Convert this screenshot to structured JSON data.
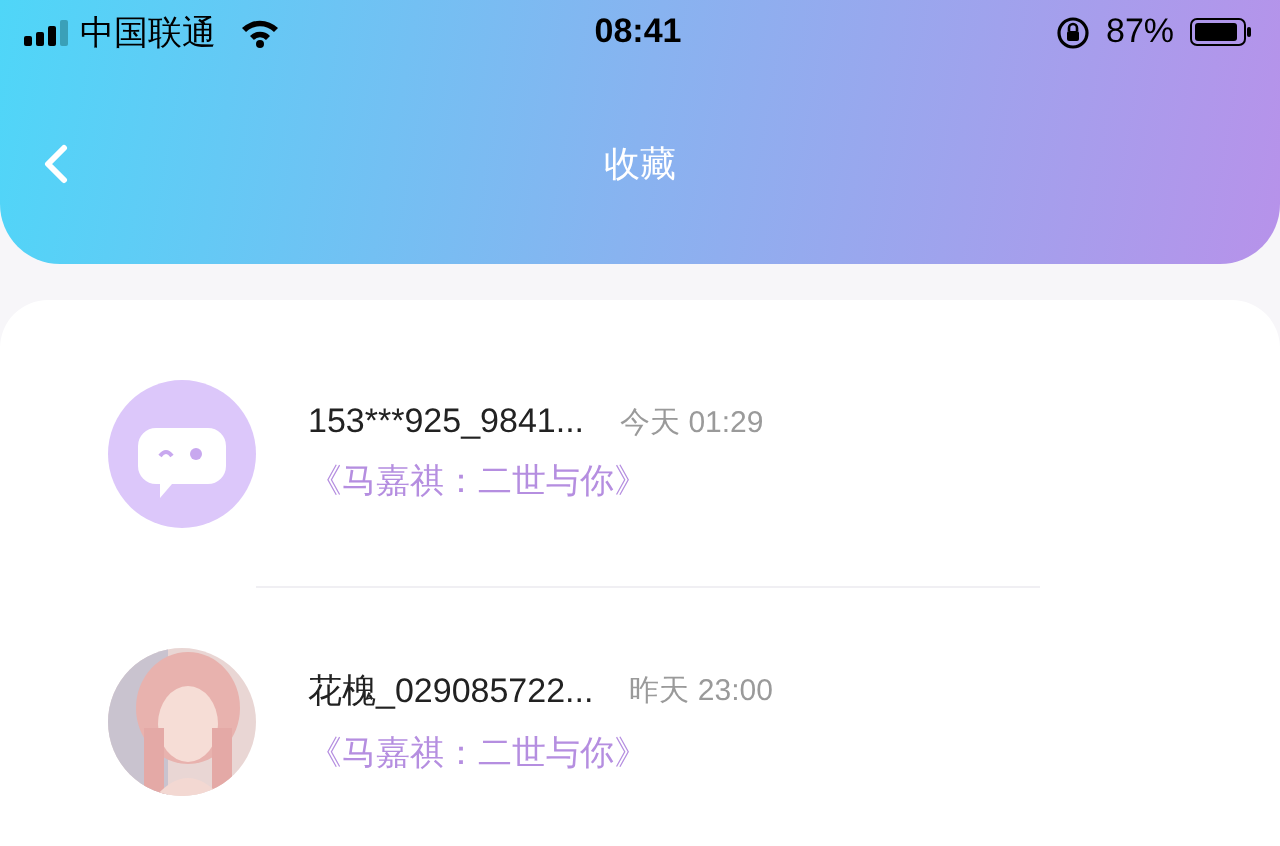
{
  "status_bar": {
    "carrier": "中国联通",
    "time": "08:41",
    "battery": "87%"
  },
  "header": {
    "title": "收藏"
  },
  "favorites": [
    {
      "avatar": {
        "kind": "icon"
      },
      "name": "153***925_9841...",
      "time": "今天 01:29",
      "book": "《马嘉祺：二世与你》"
    },
    {
      "name": "花槐_029085722...",
      "time": "昨天 23:00",
      "book": "《马嘉祺：二世与你》"
    }
  ]
}
